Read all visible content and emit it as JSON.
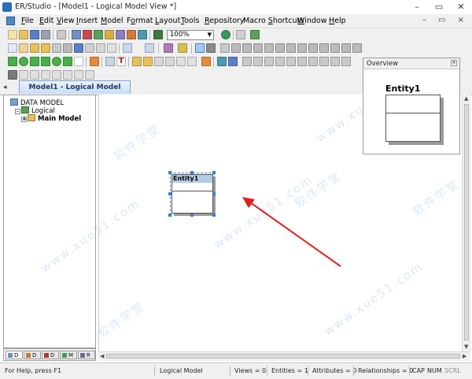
{
  "window": {
    "title": "ER/Studio - [Model1 - Logical Model View *]",
    "minimize_glyph": "–",
    "maximize_glyph": "▭",
    "close_glyph": "✕",
    "doc_controls": "– ▭ ×"
  },
  "menu": {
    "items": [
      {
        "label": "File",
        "mnemonic": "F"
      },
      {
        "label": "Edit",
        "mnemonic": "E"
      },
      {
        "label": "View",
        "mnemonic": "V"
      },
      {
        "label": "Insert",
        "mnemonic": "I"
      },
      {
        "label": "Model",
        "mnemonic": "M"
      },
      {
        "label": "Format",
        "mnemonic": "o"
      },
      {
        "label": "Layout",
        "mnemonic": "L"
      },
      {
        "label": "Tools",
        "mnemonic": "T"
      },
      {
        "label": "Repository",
        "mnemonic": "R"
      },
      {
        "label": "Macro Shortcuts",
        "mnemonic": "S"
      },
      {
        "label": "Window",
        "mnemonic": "W"
      },
      {
        "label": "Help",
        "mnemonic": "H"
      }
    ]
  },
  "toolbar": {
    "zoom_value": "100%"
  },
  "tabs": {
    "scroll_glyph": "◂",
    "active_tab": "Model1 - Logical Model View *"
  },
  "tree": {
    "root": "DATA MODEL",
    "child": "Logical",
    "grandchild": "Main Model"
  },
  "panel_tabs": [
    {
      "label": "D",
      "color": "#6e8fc4"
    },
    {
      "label": "D",
      "color": "#c07a3a"
    },
    {
      "label": "D",
      "color": "#a33b3b"
    },
    {
      "label": "M",
      "color": "#3f9b4f"
    },
    {
      "label": "R",
      "color": "#6a6a9a"
    }
  ],
  "canvas": {
    "entity_name": "Entity1"
  },
  "overview": {
    "title": "Overview",
    "close_glyph": "×",
    "entity_name": "Entity1"
  },
  "status": {
    "help": "For Help, press F1",
    "model": "Logical Model",
    "views": "Views = 0",
    "entities": "Entities = 1",
    "attributes": "Attributes = 0",
    "relationships": "Relationships = 0",
    "cap": "CAP",
    "num": "NUM",
    "scrl": "SCRL"
  },
  "watermark": {
    "text_cn": "软件学堂",
    "text_url": "www.xue51.com"
  },
  "colors": {
    "accent": "#2f7fd8",
    "arrow": "#e02020",
    "entity_header": "#b8cbe6"
  }
}
